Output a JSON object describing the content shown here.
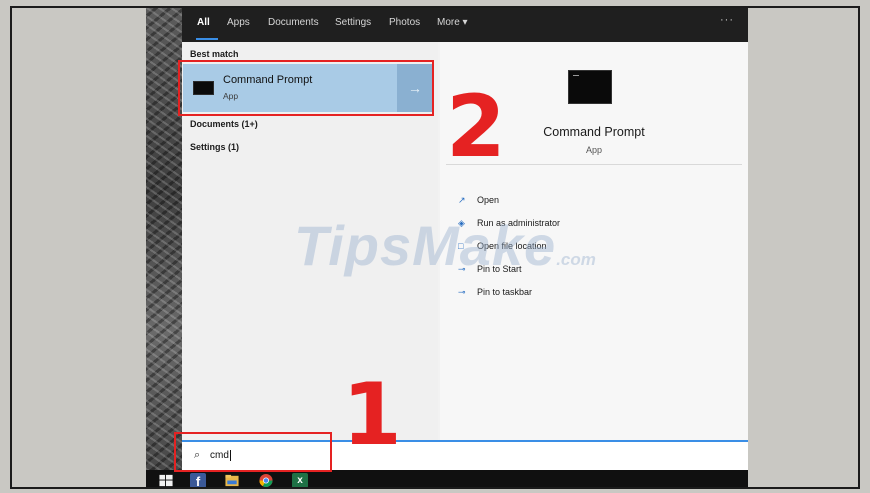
{
  "tabs": [
    "All",
    "Apps",
    "Documents",
    "Settings",
    "Photos",
    "More ▾"
  ],
  "more_dots": "···",
  "left_pane": {
    "best_match_header": "Best match",
    "best_match": {
      "title": "Command Prompt",
      "subtitle": "App",
      "arrow": "→"
    },
    "documents": "Documents (1+)",
    "settings": "Settings (1)"
  },
  "right_pane": {
    "title": "Command Prompt",
    "subtitle": "App",
    "actions": [
      {
        "label": "Open",
        "icon": "open-icon"
      },
      {
        "label": "Run as administrator",
        "icon": "shield-icon"
      },
      {
        "label": "Open file location",
        "icon": "folder-icon"
      },
      {
        "label": "Pin to Start",
        "icon": "pin-icon"
      },
      {
        "label": "Pin to taskbar",
        "icon": "pin-icon"
      }
    ]
  },
  "search": {
    "value": "cmd"
  },
  "taskbar": [
    "windows-start-icon",
    "facebook-icon",
    "file-explorer-icon",
    "chrome-icon",
    "excel-icon"
  ],
  "annotations": {
    "step1": "1",
    "step2": "2",
    "color": "#e52222"
  },
  "watermark": {
    "main": "TipsMake",
    "suffix": ".com"
  },
  "colors": {
    "accent": "#3a8ee6",
    "selection": "#a9cbe6",
    "topbar": "#1f1f1f"
  }
}
